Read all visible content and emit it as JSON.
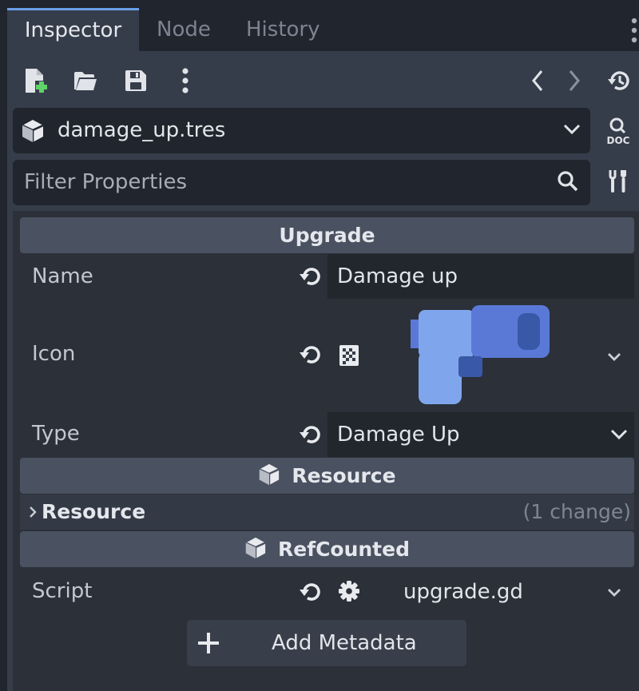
{
  "tabs": [
    {
      "label": "Inspector",
      "active": true
    },
    {
      "label": "Node",
      "active": false
    },
    {
      "label": "History",
      "active": false
    }
  ],
  "toolbar": {
    "icons": [
      "new-resource-icon",
      "open-folder-icon",
      "save-icon",
      "more-vertical-icon",
      "back-icon",
      "forward-icon",
      "history-icon"
    ]
  },
  "resource": {
    "name": "damage_up.tres",
    "doc_label": "DOC"
  },
  "filter": {
    "placeholder": "Filter Properties"
  },
  "sections": {
    "upgrade": "Upgrade",
    "resource": "Resource",
    "refcounted": "RefCounted"
  },
  "properties": {
    "name": {
      "label": "Name",
      "value": "Damage up"
    },
    "icon": {
      "label": "Icon"
    },
    "type": {
      "label": "Type",
      "value": "Damage Up"
    },
    "script": {
      "label": "Script",
      "value": "upgrade.gd"
    }
  },
  "resource_group": {
    "label": "Resource",
    "change": "(1 change)"
  },
  "add_metadata": {
    "label": "Add Metadata"
  },
  "colors": {
    "accent": "#6a9fe6",
    "panel": "#363d4a",
    "field": "#21262e",
    "section": "#4a5160",
    "add_green": "#5fd36a"
  }
}
